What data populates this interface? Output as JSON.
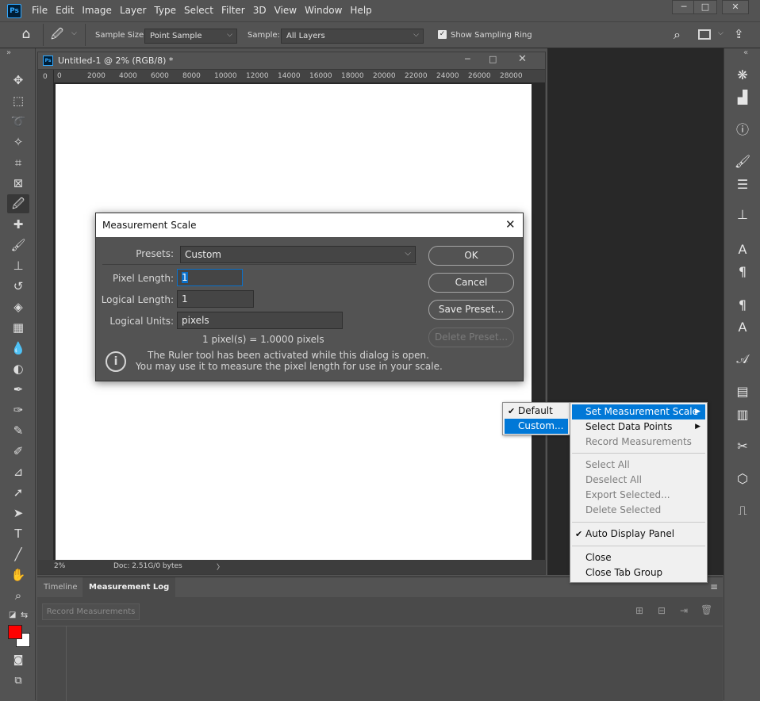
{
  "app": {
    "logo_text": "Ps",
    "menu": [
      "File",
      "Edit",
      "Image",
      "Layer",
      "Type",
      "Select",
      "Filter",
      "3D",
      "View",
      "Window",
      "Help"
    ],
    "window_controls": [
      "─",
      "□",
      "✕"
    ]
  },
  "options_bar": {
    "sample_size_label": "Sample Size:",
    "sample_size_value": "Point Sample",
    "sample_label": "Sample:",
    "sample_value": "All Layers",
    "show_ring_label": "Show Sampling Ring",
    "show_ring_checked": true
  },
  "document": {
    "title": "Untitled-1 @ 2% (RGB/8) *",
    "ruler_ticks": [
      "0",
      "2000",
      "4000",
      "6000",
      "8000",
      "10000",
      "12000",
      "14000",
      "16000",
      "18000",
      "20000",
      "22000",
      "24000",
      "26000",
      "28000"
    ],
    "vruler_first": "0",
    "zoom": "2%",
    "doc_info": "Doc: 2.51G/0 bytes",
    "status_arrow": "〉"
  },
  "dialog": {
    "title": "Measurement Scale",
    "presets_label": "Presets:",
    "presets_value": "Custom",
    "pixel_length_label": "Pixel Length:",
    "pixel_length_value": "1",
    "logical_length_label": "Logical Length:",
    "logical_length_value": "1",
    "logical_units_label": "Logical Units:",
    "logical_units_value": "pixels",
    "scale_summary": "1 pixel(s) = 1.0000 pixels",
    "info_line1": "The Ruler tool has been activated while this dialog is open.",
    "info_line2": "You may use it to measure the pixel length for use in your scale.",
    "ok_label": "OK",
    "cancel_label": "Cancel",
    "save_preset_label": "Save Preset...",
    "delete_preset_label": "Delete Preset..."
  },
  "log_panel": {
    "tabs": [
      "Timeline",
      "Measurement Log"
    ],
    "active_tab": "Measurement Log",
    "record_button": "Record Measurements"
  },
  "submenu": {
    "items": [
      {
        "label": "Default",
        "checked": true
      },
      {
        "label": "Custom...",
        "highlighted": true
      }
    ]
  },
  "context_menu": {
    "items": [
      {
        "label": "Set Measurement Scale",
        "highlighted": true,
        "submenu": true
      },
      {
        "label": "Select Data Points",
        "submenu": true
      },
      {
        "label": "Record Measurements",
        "disabled": true
      },
      {
        "label": "Select All",
        "disabled": true
      },
      {
        "label": "Deselect All",
        "disabled": true
      },
      {
        "label": "Export Selected...",
        "disabled": true
      },
      {
        "label": "Delete Selected",
        "disabled": true
      },
      {
        "label": "Auto Display Panel",
        "checked": true
      },
      {
        "label": "Close"
      },
      {
        "label": "Close Tab Group"
      }
    ]
  },
  "colors": {
    "foreground": "#ff0000",
    "background": "#ffffff",
    "highlight": "#0078d7"
  }
}
